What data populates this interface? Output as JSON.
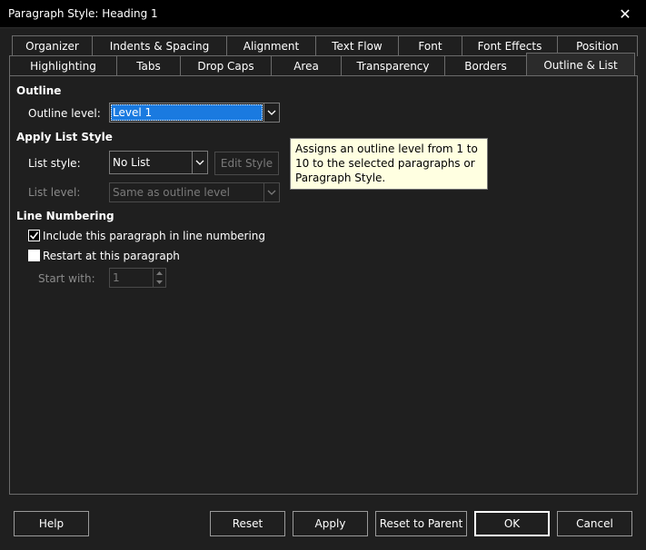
{
  "window": {
    "title": "Paragraph Style: Heading 1",
    "close_glyph": "✕"
  },
  "tabs": {
    "row1": [
      "Organizer",
      "Indents & Spacing",
      "Alignment",
      "Text Flow",
      "Font",
      "Font Effects",
      "Position"
    ],
    "row2": [
      "Highlighting",
      "Tabs",
      "Drop Caps",
      "Area",
      "Transparency",
      "Borders",
      "Outline & List"
    ],
    "active": "Outline & List"
  },
  "outline": {
    "heading": "Outline",
    "level_label": "Outline level:",
    "level_value": "Level 1"
  },
  "list_style": {
    "heading": "Apply List Style",
    "style_label": "List style:",
    "style_value": "No List",
    "edit_style_button": "Edit Style",
    "level_label": "List level:",
    "level_value": "Same as outline level"
  },
  "line_numbering": {
    "heading": "Line Numbering",
    "include_label": "Include this paragraph in line numbering",
    "include_checked": true,
    "restart_label": "Restart at this paragraph",
    "restart_checked": false,
    "start_with_label": "Start with:",
    "start_with_value": "1"
  },
  "tooltip": {
    "text": "Assigns an outline level from 1 to 10 to the selected paragraphs or Paragraph Style."
  },
  "buttons": {
    "help": "Help",
    "reset": "Reset",
    "apply": "Apply",
    "reset_to_parent": "Reset to Parent",
    "ok": "OK",
    "cancel": "Cancel"
  },
  "icons": {
    "chevron": "chevron-down-icon",
    "check": "checkmark-icon",
    "spin_up": "spin-up-icon",
    "spin_down": "spin-down-icon"
  },
  "colors": {
    "background": "#1f1f1f",
    "titlebar": "#000000",
    "selection": "#1a7ae0",
    "tooltip_bg": "#ffffe1"
  }
}
